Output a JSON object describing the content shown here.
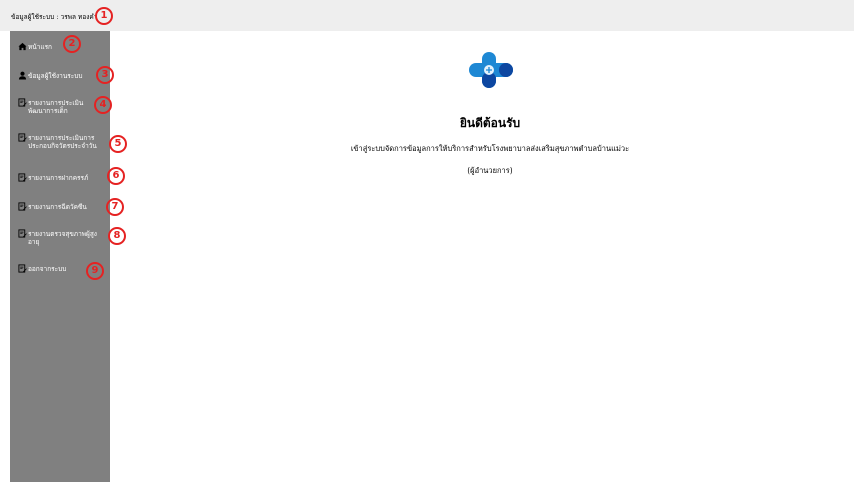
{
  "topbar": {
    "user_info": "ข้อมูลผู้ใช้ระบบ : วรพล ทองคำ"
  },
  "sidebar": {
    "items": [
      {
        "label": "หน้าแรก",
        "icon": "home-icon"
      },
      {
        "label": "ข้อมูลผู้ใช้งานระบบ",
        "icon": "user-icon"
      },
      {
        "label": "รายงานการประเมินพัฒนาการเด็ก",
        "icon": "report-icon"
      },
      {
        "label": "รายงานการประเมินการประกอบกิจวัตรประจำวัน",
        "icon": "report-icon"
      },
      {
        "label": "รายงานการฝากครรภ์",
        "icon": "report-icon"
      },
      {
        "label": "รายงานการฉีดวัคซีน",
        "icon": "report-icon"
      },
      {
        "label": "รายงานตรวจสุขภาพผู้สูงอายุ",
        "icon": "report-icon"
      },
      {
        "label": "ออกจากระบบ",
        "icon": "report-icon"
      }
    ]
  },
  "badges": [
    "1",
    "2",
    "3",
    "4",
    "5",
    "6",
    "7",
    "8",
    "9"
  ],
  "main": {
    "welcome": "ยินดีต้อนรับ",
    "description": "เข้าสู่ระบบจัดการข้อมูลการให้บริการสำหรับโรงพยาบาลส่งเสริมสุขภาพตำบลบ้านแม่วะ",
    "role": "(ผู้อำนวยการ)"
  },
  "colors": {
    "sidebar_bg": "#808080",
    "topbar_bg": "#eeeeee",
    "badge": "#e52222",
    "logo_blue": "#1e88d4",
    "logo_dark": "#0d47a1"
  }
}
